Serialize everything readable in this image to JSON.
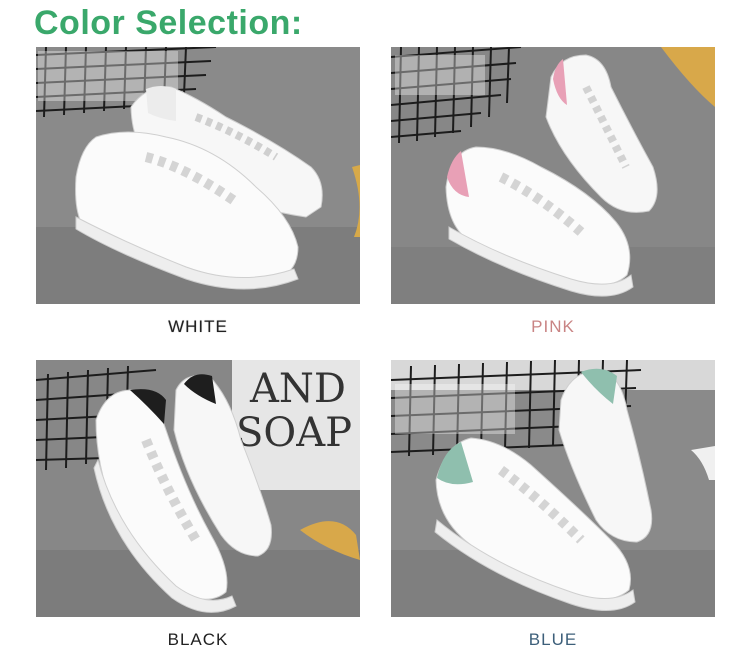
{
  "heading": "Color Selection:",
  "colors": {
    "title": "#3aa86b",
    "white_label": "#222222",
    "pink_label": "#c98484",
    "black_label": "#222222",
    "blue_label": "#3d5f7a",
    "pink_accent": "#e8a0b6",
    "black_accent": "#1e1e1e",
    "blue_accent": "#8fbfae"
  },
  "options": [
    {
      "label": "WHITE",
      "image": "white-sneakers"
    },
    {
      "label": "PINK",
      "image": "pink-heel-sneakers"
    },
    {
      "label": "BLACK",
      "image": "black-heel-sneakers"
    },
    {
      "label": "BLUE",
      "image": "blue-heel-sneakers"
    }
  ],
  "backdrop_text": [
    "AND",
    "SOAP"
  ]
}
